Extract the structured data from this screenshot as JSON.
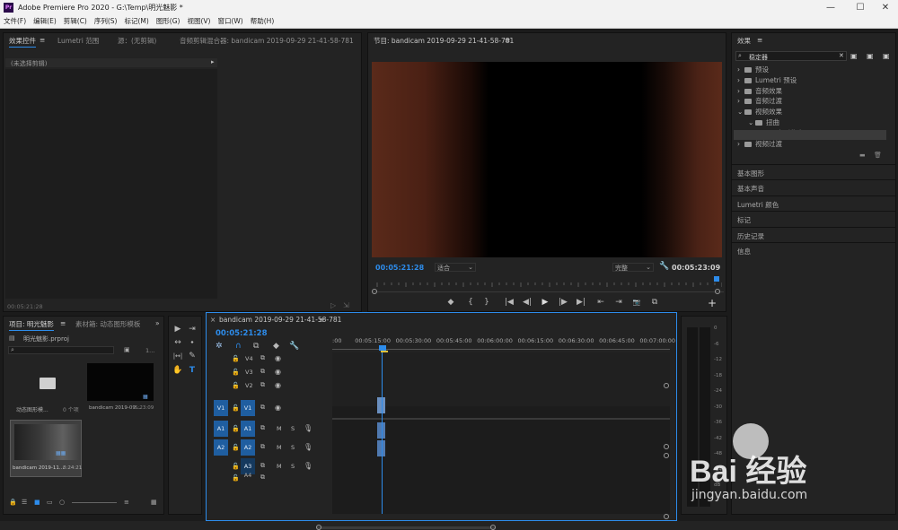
{
  "window": {
    "title": "Adobe Premiere Pro 2020 - G:\\Temp\\明光魅影 *",
    "logo": "Pr",
    "minimize": "—",
    "maximize": "☐",
    "close": "✕"
  },
  "menu": [
    "文件(F)",
    "编辑(E)",
    "剪辑(C)",
    "序列(S)",
    "标记(M)",
    "图形(G)",
    "视图(V)",
    "窗口(W)",
    "帮助(H)"
  ],
  "source_panel": {
    "tabs": [
      "效果控件",
      "Lumetri 范围",
      "源：(无剪辑)",
      "音频剪辑混合器: bandicam 2019-09-29 21-41-58-781"
    ],
    "menu_icon": "≡",
    "no_clip": "(未选择剪辑)",
    "timecode": "00:05:21:28"
  },
  "program": {
    "title": "节目: bandicam 2019-09-29 21-41-58-781",
    "menu_icon": "≡",
    "timecode": "00:05:21:28",
    "fit": "适合",
    "quality": "完整",
    "duration": "00:05:23:09",
    "playhead_fraction": 0.985,
    "transport": [
      "◆",
      "{",
      "}",
      "|◀",
      "◀|",
      "▶",
      "|▶",
      "▶|",
      "⇤",
      "⇥",
      "📷",
      "⧉"
    ],
    "add": "+"
  },
  "project": {
    "tabs": [
      "项目: 明光魅影",
      "素材箱: 动态图形模板"
    ],
    "menu_icon": "≡",
    "overflow": "»",
    "file": "明光魅影.prproj",
    "count": "1...",
    "items": [
      {
        "name": "动态图形模...",
        "meta": "0 个项",
        "type": "bin"
      },
      {
        "name": "bandicam 2019-09...",
        "meta": "5:23:09",
        "type": "clip"
      },
      {
        "name": "bandicam 2019-11...",
        "meta": "8:24:21",
        "type": "clip"
      }
    ]
  },
  "tools": [
    "▶",
    "⇥",
    "↔",
    "⬩",
    "|↔|",
    "✎",
    "✋",
    "T"
  ],
  "timeline": {
    "title": "bandicam 2019-09-29 21-41-58-781",
    "menu_icon": "≡",
    "close_icon": "×",
    "timecode": "00:05:21:28",
    "ruler": [
      ":00",
      "00:05:15:00",
      "00:05:30:00",
      "00:05:45:00",
      "00:06:00:00",
      "00:06:15:00",
      "00:06:30:00",
      "00:06:45:00",
      "00:07:00:00"
    ],
    "video_tracks": [
      "V4",
      "V3",
      "V2",
      "V1"
    ],
    "audio_tracks": [
      "A1",
      "A2",
      "A3",
      "A4"
    ],
    "source_v": "V1",
    "source_a": [
      "A1",
      "A2"
    ],
    "m": "M",
    "s": "S",
    "meter_scale": [
      "0",
      "-6",
      "-12",
      "-18",
      "-24",
      "-30",
      "-36",
      "-42",
      "-48",
      "-54",
      "dB"
    ]
  },
  "effects": {
    "title": "效果",
    "menu_icon": "≡",
    "search": "稳定器",
    "tree": [
      {
        "label": "预设",
        "level": 0,
        "arrow": "›"
      },
      {
        "label": "Lumetri 预设",
        "level": 0,
        "arrow": "›"
      },
      {
        "label": "音频效果",
        "level": 0,
        "arrow": "›"
      },
      {
        "label": "音频过渡",
        "level": 0,
        "arrow": "›"
      },
      {
        "label": "视频效果",
        "level": 0,
        "arrow": "⌄"
      },
      {
        "label": "扭曲",
        "level": 1,
        "arrow": "⌄"
      },
      {
        "label": "变形稳定器",
        "level": 2,
        "arrow": ""
      },
      {
        "label": "视频过渡",
        "level": 0,
        "arrow": "›"
      }
    ],
    "sections": [
      "基本图形",
      "基本声音",
      "Lumetri 颜色",
      "标记",
      "历史记录",
      "信息"
    ]
  },
  "watermark": {
    "text": "Bai 经验",
    "url": "jingyan.baidu.com"
  },
  "colors": {
    "accent": "#2d8ceb",
    "track": "#1f5ea0",
    "clip": "#6a8fbf"
  }
}
